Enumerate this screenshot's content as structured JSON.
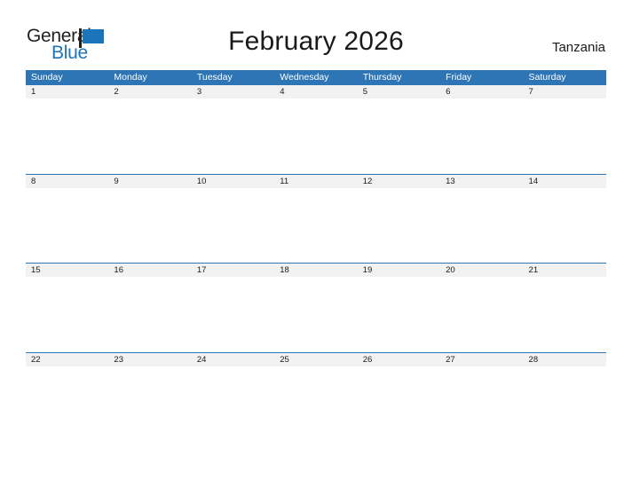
{
  "brand": {
    "name_part1": "General",
    "name_part2": "Blue",
    "flag_icon": "flag-triangle-icon",
    "color_dark": "#221f1f",
    "color_blue": "#1b75bb"
  },
  "header": {
    "title": "February 2026",
    "locale": "Tanzania"
  },
  "calendar": {
    "header_color": "#2e75b6",
    "date_band_color": "#f2f2f2",
    "weekdays": [
      "Sunday",
      "Monday",
      "Tuesday",
      "Wednesday",
      "Thursday",
      "Friday",
      "Saturday"
    ],
    "weeks": [
      {
        "days": [
          "1",
          "2",
          "3",
          "4",
          "5",
          "6",
          "7"
        ]
      },
      {
        "days": [
          "8",
          "9",
          "10",
          "11",
          "12",
          "13",
          "14"
        ]
      },
      {
        "days": [
          "15",
          "16",
          "17",
          "18",
          "19",
          "20",
          "21"
        ]
      },
      {
        "days": [
          "22",
          "23",
          "24",
          "25",
          "26",
          "27",
          "28"
        ]
      }
    ]
  }
}
